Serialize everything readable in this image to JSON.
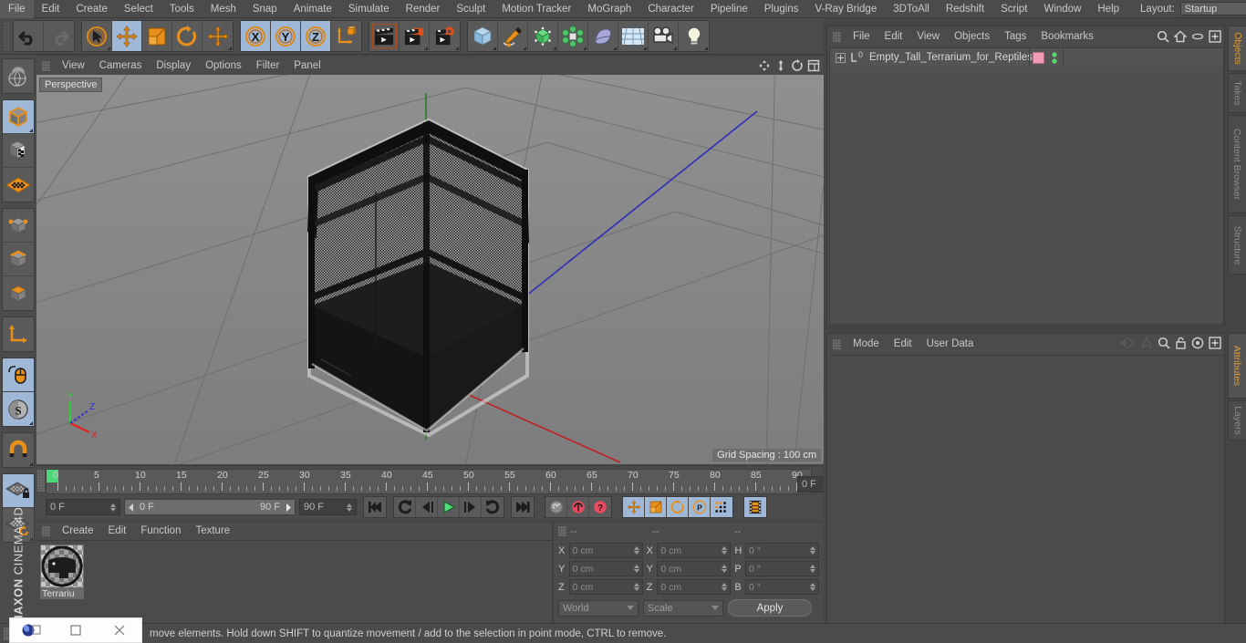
{
  "app": {
    "brand_line1": "MAXON",
    "brand_line2": "CINEMA 4D"
  },
  "menubar": {
    "items": [
      "File",
      "Edit",
      "Create",
      "Select",
      "Tools",
      "Mesh",
      "Snap",
      "Animate",
      "Simulate",
      "Render",
      "Sculpt",
      "Motion Tracker",
      "MoGraph",
      "Character",
      "Pipeline",
      "Plugins",
      "V-Ray Bridge",
      "3DToAll",
      "Redshift",
      "Script",
      "Window",
      "Help"
    ],
    "layout_label": "Layout:",
    "layout_value": "Startup",
    "search_icon": "search-icon"
  },
  "viewport": {
    "menu": [
      "View",
      "Cameras",
      "Display",
      "Options",
      "Filter",
      "Panel"
    ],
    "label": "Perspective",
    "grid_spacing": "Grid Spacing : 100 cm",
    "axis": {
      "x": "X",
      "y": "Y",
      "z": "Z"
    },
    "icons": [
      "move-icon",
      "scale-icon",
      "rotate-icon",
      "maximize-icon"
    ]
  },
  "timeline": {
    "ticks": [
      "0",
      "5",
      "10",
      "15",
      "20",
      "25",
      "30",
      "35",
      "40",
      "45",
      "50",
      "55",
      "60",
      "65",
      "70",
      "75",
      "80",
      "85",
      "90"
    ],
    "current_frame": "0 F",
    "range_start": "0 F",
    "range_end": "90 F",
    "end_frame": "90 F",
    "preview_frame": "0 F",
    "transport": [
      "go-to-start-icon",
      "play-reverse-loop-icon",
      "step-back-icon",
      "play-icon",
      "step-forward-icon",
      "loop-icon",
      "go-to-end-icon"
    ],
    "keys": [
      "record-key-icon",
      "autokey-icon",
      "keyframe-help-icon"
    ],
    "key_toggles": [
      "position-key-icon",
      "scale-key-icon",
      "rotation-key-icon",
      "param-key-icon",
      "pla-key-icon"
    ],
    "filmstrip": "filmstrip-icon"
  },
  "materials": {
    "menu": [
      "Create",
      "Edit",
      "Function",
      "Texture"
    ],
    "items": [
      {
        "name": "Terrariu"
      }
    ]
  },
  "coords": {
    "headers": [
      "--",
      "--",
      "--"
    ],
    "rows": [
      {
        "pos_label": "X",
        "pos_value": "0 cm",
        "size_label": "X",
        "size_value": "0 cm",
        "rot_label": "H",
        "rot_value": "0 °"
      },
      {
        "pos_label": "Y",
        "pos_value": "0 cm",
        "size_label": "Y",
        "size_value": "0 cm",
        "rot_label": "P",
        "rot_value": "0 °"
      },
      {
        "pos_label": "Z",
        "pos_value": "0 cm",
        "size_label": "Z",
        "size_value": "0 cm",
        "rot_label": "B",
        "rot_value": "0 °"
      }
    ],
    "system": "World",
    "mode": "Scale",
    "apply": "Apply"
  },
  "object_manager": {
    "menu": [
      "File",
      "Edit",
      "View",
      "Objects",
      "Tags",
      "Bookmarks"
    ],
    "icons": [
      "search-icon",
      "home-icon",
      "eye-icon",
      "add-icon"
    ],
    "objects": [
      {
        "name": "Empty_Tall_Terrarium_for_Reptiles",
        "tag_icon": "layer-0-icon",
        "material_color": "#f19bb4",
        "visibility_dots": 2
      }
    ]
  },
  "attribute_manager": {
    "menu": [
      "Mode",
      "Edit",
      "User Data"
    ],
    "icons": [
      "back-nav-icon",
      "forward-nav-icon",
      "search-icon",
      "lock-icon",
      "target-icon",
      "add-icon"
    ]
  },
  "right_tabs_top": [
    {
      "label": "Objects",
      "active": true
    },
    {
      "label": "Takes",
      "active": false
    },
    {
      "label": "Content Browser",
      "active": false
    },
    {
      "label": "Structure",
      "active": false
    }
  ],
  "right_tabs_bottom": [
    {
      "label": "Attributes",
      "active": true
    },
    {
      "label": "Layers",
      "active": false
    }
  ],
  "statusbar": {
    "text": "move elements. Hold down SHIFT to quantize movement / add to the selection in point mode, CTRL to remove.",
    "window_controls": [
      "app-icon",
      "restore-icon",
      "maximize-icon",
      "close-icon"
    ]
  },
  "toolbar": {
    "groups": [
      {
        "buttons": [
          {
            "icon": "undo-icon",
            "selected": false
          },
          {
            "icon": "redo-icon",
            "selected": false
          }
        ]
      },
      {
        "buttons": [
          {
            "icon": "live-selection-icon",
            "selected": false
          },
          {
            "icon": "move-tool-icon",
            "selected": true
          },
          {
            "icon": "scale-tool-icon",
            "selected": false
          },
          {
            "icon": "rotate-tool-icon",
            "selected": false
          },
          {
            "icon": "move-alt-icon",
            "selected": false
          }
        ]
      },
      {
        "buttons": [
          {
            "icon": "x-axis-icon",
            "selected": true
          },
          {
            "icon": "y-axis-icon",
            "selected": true
          },
          {
            "icon": "z-axis-icon",
            "selected": true
          },
          {
            "icon": "world-object-axis-icon",
            "selected": false
          }
        ]
      },
      {
        "buttons": [
          {
            "icon": "render-view-icon",
            "selected": false
          },
          {
            "icon": "render-region-icon",
            "selected": false
          },
          {
            "icon": "render-settings-icon",
            "selected": false
          }
        ]
      },
      {
        "buttons": [
          {
            "icon": "cube-primitive-icon",
            "selected": false
          },
          {
            "icon": "spline-pen-icon",
            "selected": false
          },
          {
            "icon": "nurbs-icon",
            "selected": false
          },
          {
            "icon": "mograph-icon",
            "selected": false
          },
          {
            "icon": "deformer-icon",
            "selected": false
          },
          {
            "icon": "scene-floor-icon",
            "selected": false
          },
          {
            "icon": "camera-icon",
            "selected": false
          },
          {
            "icon": "light-icon",
            "selected": false
          }
        ]
      }
    ]
  },
  "left_toolbar": {
    "groups": [
      {
        "buttons": [
          {
            "icon": "viewport-globe-icon",
            "selected": false
          }
        ]
      },
      {
        "buttons": [
          {
            "icon": "model-mode-icon",
            "selected": true
          },
          {
            "icon": "texture-mode-icon",
            "selected": false
          },
          {
            "icon": "polygon-grid-icon",
            "selected": false
          }
        ]
      },
      {
        "buttons": [
          {
            "icon": "point-mode-icon",
            "selected": false
          },
          {
            "icon": "edge-mode-icon",
            "selected": false
          },
          {
            "icon": "polygon-mode-icon",
            "selected": false
          }
        ]
      },
      {
        "buttons": [
          {
            "icon": "object-axis-icon",
            "selected": false
          }
        ]
      },
      {
        "buttons": [
          {
            "icon": "viewport-mouse-icon",
            "selected": true
          },
          {
            "icon": "soft-selection-icon",
            "selected": true
          }
        ]
      },
      {
        "buttons": [
          {
            "icon": "magnet-icon",
            "selected": false
          }
        ]
      },
      {
        "buttons": [
          {
            "icon": "workplane-lock-icon",
            "selected": true
          },
          {
            "icon": "workplane-rotate-icon",
            "selected": false
          }
        ]
      }
    ]
  }
}
